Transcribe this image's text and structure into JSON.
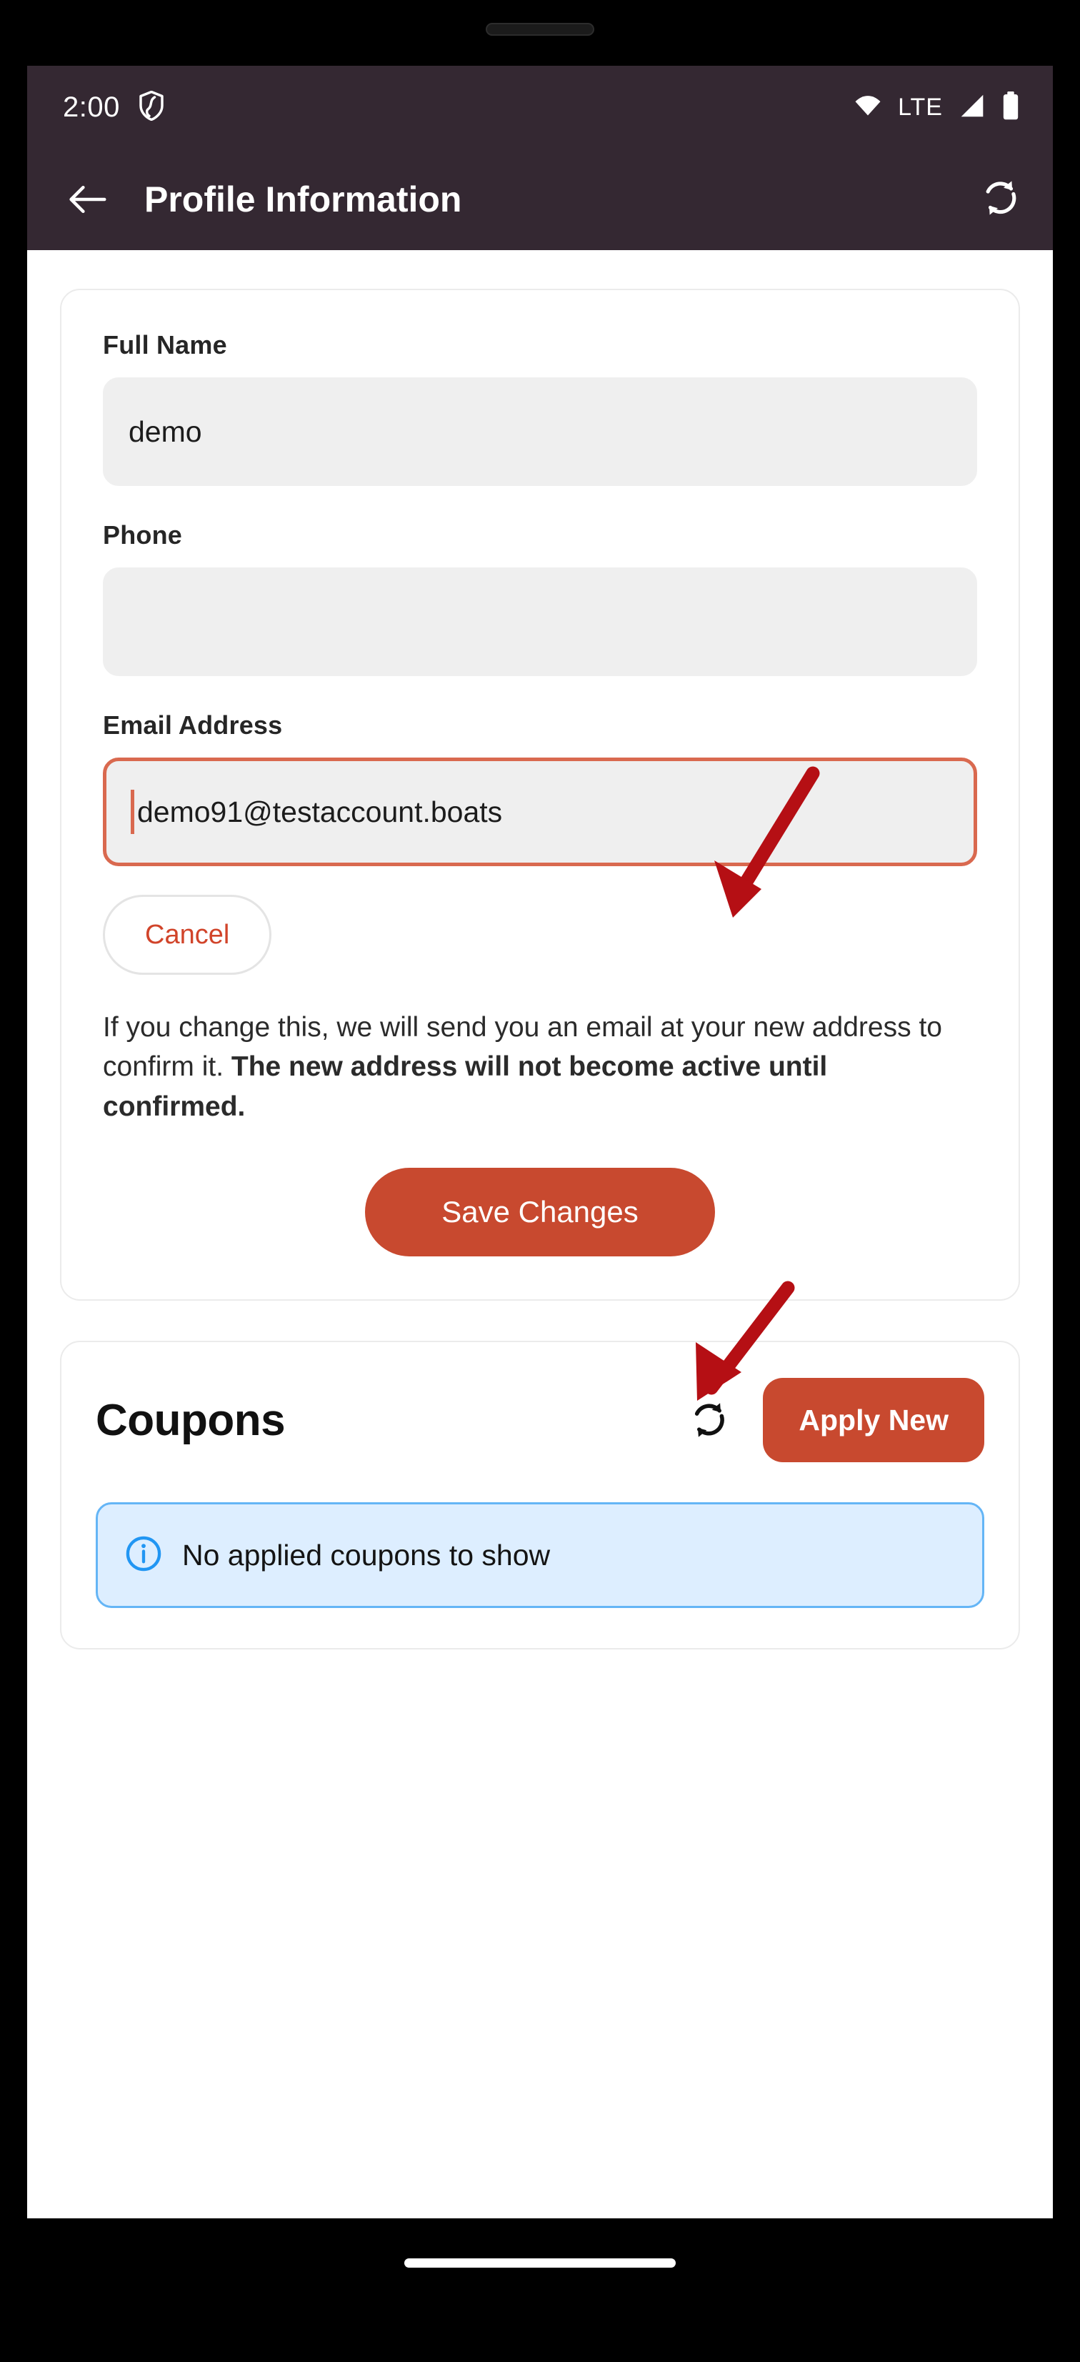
{
  "status_bar": {
    "clock": "2:00",
    "shield_icon": "shield-icon",
    "wifi_icon": "wifi-icon",
    "network_label": "LTE",
    "signal_icon": "signal-bars-icon",
    "battery_icon": "battery-icon"
  },
  "app_bar": {
    "back_icon": "back-arrow-icon",
    "title": "Profile Information",
    "sync_icon": "sync-icon"
  },
  "profile_form": {
    "full_name": {
      "label": "Full Name",
      "value": "demo",
      "placeholder": ""
    },
    "phone": {
      "label": "Phone",
      "value": "",
      "placeholder": ""
    },
    "email": {
      "label": "Email Address",
      "value": "demo91@testaccount.boats",
      "placeholder": "",
      "focused": true
    },
    "cancel_label": "Cancel",
    "helper_text_normal": "If you change this, we will send you an email at your new address to confirm it. ",
    "helper_text_bold": "The new address will not become active until confirmed.",
    "save_label": "Save Changes"
  },
  "coupons": {
    "title": "Coupons",
    "refresh_icon": "refresh-icon",
    "apply_new_label": "Apply New",
    "empty_icon": "info-icon",
    "empty_message": "No applied coupons to show"
  },
  "colors": {
    "app_bar_background": "#342832",
    "brand_red": "#c8492f",
    "focus_border": "#d9694f",
    "cancel_text": "#d1442a",
    "info_banner_background": "#ddeeff",
    "info_banner_border": "#64b5f6",
    "input_background": "#efefef",
    "annotation_arrow": "#b50f14"
  },
  "annotations": {
    "arrow_email": "arrow-pointing-to-email-field",
    "arrow_save": "arrow-pointing-to-save-changes-button"
  }
}
